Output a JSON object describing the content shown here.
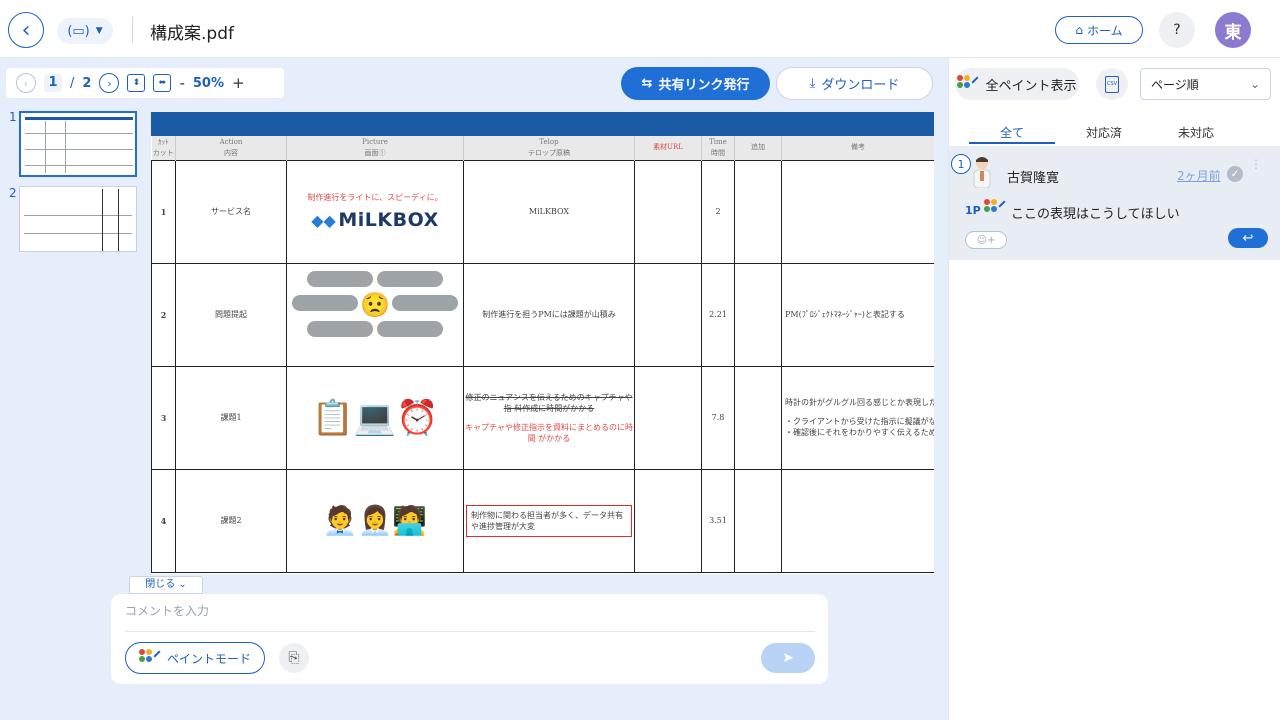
{
  "header": {
    "back_icon": "chevron-left-icon",
    "view_toggle_icon": "view-mode-icon",
    "title": "構成案.pdf",
    "home_label": "ホーム",
    "help_label": "?",
    "avatar_initial": "東"
  },
  "toolbar": {
    "current_page": "1",
    "separator": "/",
    "total_pages": "2",
    "zoom_minus": "-",
    "zoom": "50%",
    "zoom_plus": "+",
    "share_label": "共有リンク発行",
    "download_label": "ダウンロード"
  },
  "thumbnails": [
    {
      "num": "1"
    },
    {
      "num": "2"
    }
  ],
  "document": {
    "columns": [
      {
        "en": "ｶｯﾄ",
        "ja": "カット"
      },
      {
        "en": "Action",
        "ja": "内容"
      },
      {
        "en": "Picture",
        "ja": "画面①"
      },
      {
        "en": "Telop",
        "ja": "テロップ原稿"
      },
      {
        "en": "素材URL",
        "ja": ""
      },
      {
        "en": "Time",
        "ja": "時間"
      },
      {
        "en": "追加",
        "ja": ""
      },
      {
        "en": "備考",
        "ja": ""
      }
    ],
    "rows": [
      {
        "num": "1",
        "action": "サービス名",
        "picture_caption": "制作進行をライトに、スピーディに。",
        "logo": "MiLKBOX",
        "telop": "MiLKBOX",
        "time": "2",
        "note": ""
      },
      {
        "num": "2",
        "action": "問題提起",
        "telop": "制作進行を担うPMには課題が山積み",
        "time": "2.21",
        "note": "PM(ﾌﾟﾛｼﾞｪｸﾄﾏﾈｰｼﾞｬｰ)と表記する"
      },
      {
        "num": "3",
        "action": "課題1",
        "telop_struck": "修正のニュアンスを伝えるためのキャプチャや指 料作成に時間がかかる",
        "telop_red": "キャプチャや修正指示を資料にまとめるのに時間 がかかる",
        "time": "7.8",
        "note_1": "時計の針がグルグル回る感じとか表現したい",
        "note_2": "・クライアントから受けた指示に擬議がない",
        "note_3": "・確認後にそれをわかりやすく伝えるために"
      },
      {
        "num": "4",
        "action": "課題2",
        "telop": "制作物に関わる担当者が多く、データ共有や進捗管理が大変",
        "time": "3.51",
        "note": ""
      }
    ]
  },
  "composer": {
    "close_label": "閉じる",
    "placeholder": "コメントを入力",
    "paint_mode_label": "ペイントモード"
  },
  "sidepanel": {
    "show_all_label": "全ペイント表示",
    "csv_label": "CSV",
    "sort_value": "ページ順",
    "tabs": [
      "全て",
      "対応済",
      "未対応"
    ],
    "comment": {
      "number": "1",
      "user": "古賀隆寛",
      "time": "2ヶ月前",
      "page": "1P",
      "text": "ここの表現はこうしてほしい",
      "react_label": "☺+"
    }
  },
  "colors": {
    "accent": "#1f6fd6",
    "brand": "#1f5fbf",
    "doc_header": "#1b5aa5",
    "highlight": "#d9302c"
  }
}
